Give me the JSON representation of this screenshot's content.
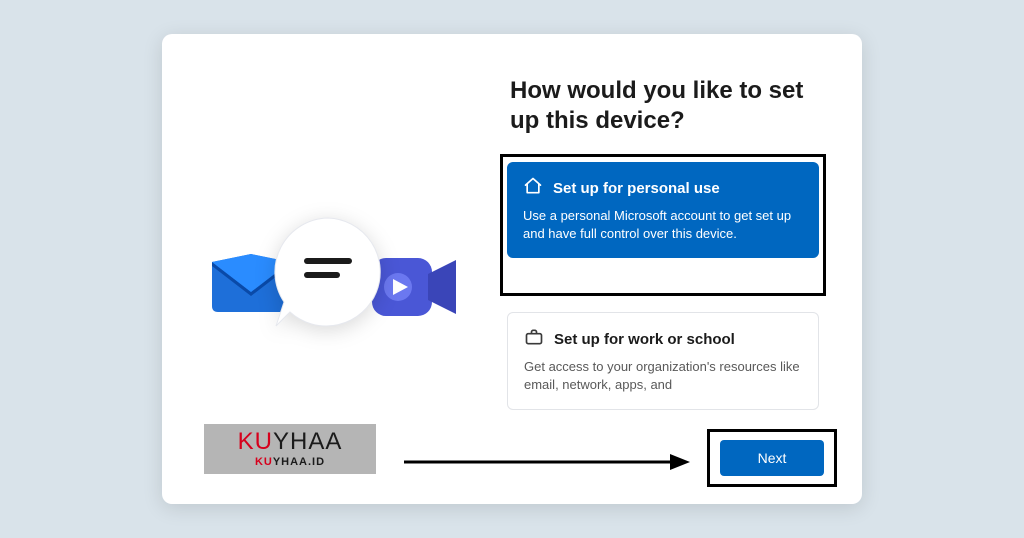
{
  "heading": "How would you like to set up this device?",
  "options": {
    "personal": {
      "title": "Set up for personal use",
      "desc": "Use a personal Microsoft account to get set up and have full control over this device."
    },
    "work": {
      "title": "Set up for work or school",
      "desc": "Get access to your organization's resources like email, network, apps, and"
    }
  },
  "next_label": "Next",
  "watermark": {
    "big_red": "KU",
    "big_black": "YHAA",
    "small_red": "KU",
    "small_black": "YHAA.ID"
  }
}
